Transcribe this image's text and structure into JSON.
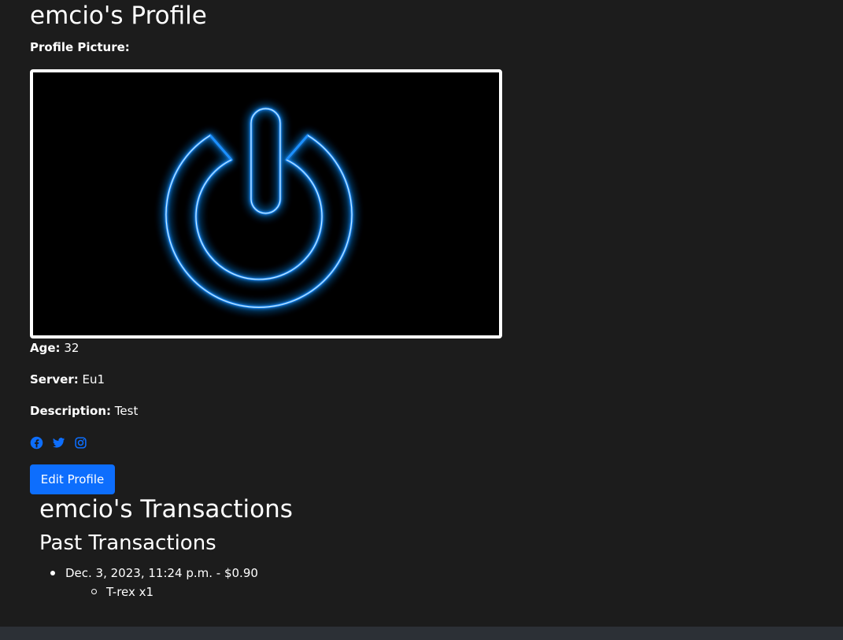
{
  "profile": {
    "title": "emcio's Profile",
    "picture_label": "Profile Picture:",
    "age_label": "Age:",
    "age_value": "32",
    "server_label": "Server:",
    "server_value": "Eu1",
    "description_label": "Description:",
    "description_value": "Test",
    "socials": [
      {
        "icon": "facebook-icon"
      },
      {
        "icon": "twitter-icon"
      },
      {
        "icon": "instagram-icon"
      }
    ],
    "edit_button_label": "Edit Profile",
    "picture_icon": "power-icon"
  },
  "transactions": {
    "title": "emcio's Transactions",
    "subtitle": "Past Transactions",
    "items": [
      {
        "label": "Dec. 3, 2023, 11:24 p.m. - $0.90",
        "products": [
          "T-rex x1"
        ]
      }
    ]
  },
  "colors": {
    "background": "#1c1c1c",
    "accent": "#0d6efd",
    "footer": "#2c3036",
    "glow": "#1e90ff"
  }
}
